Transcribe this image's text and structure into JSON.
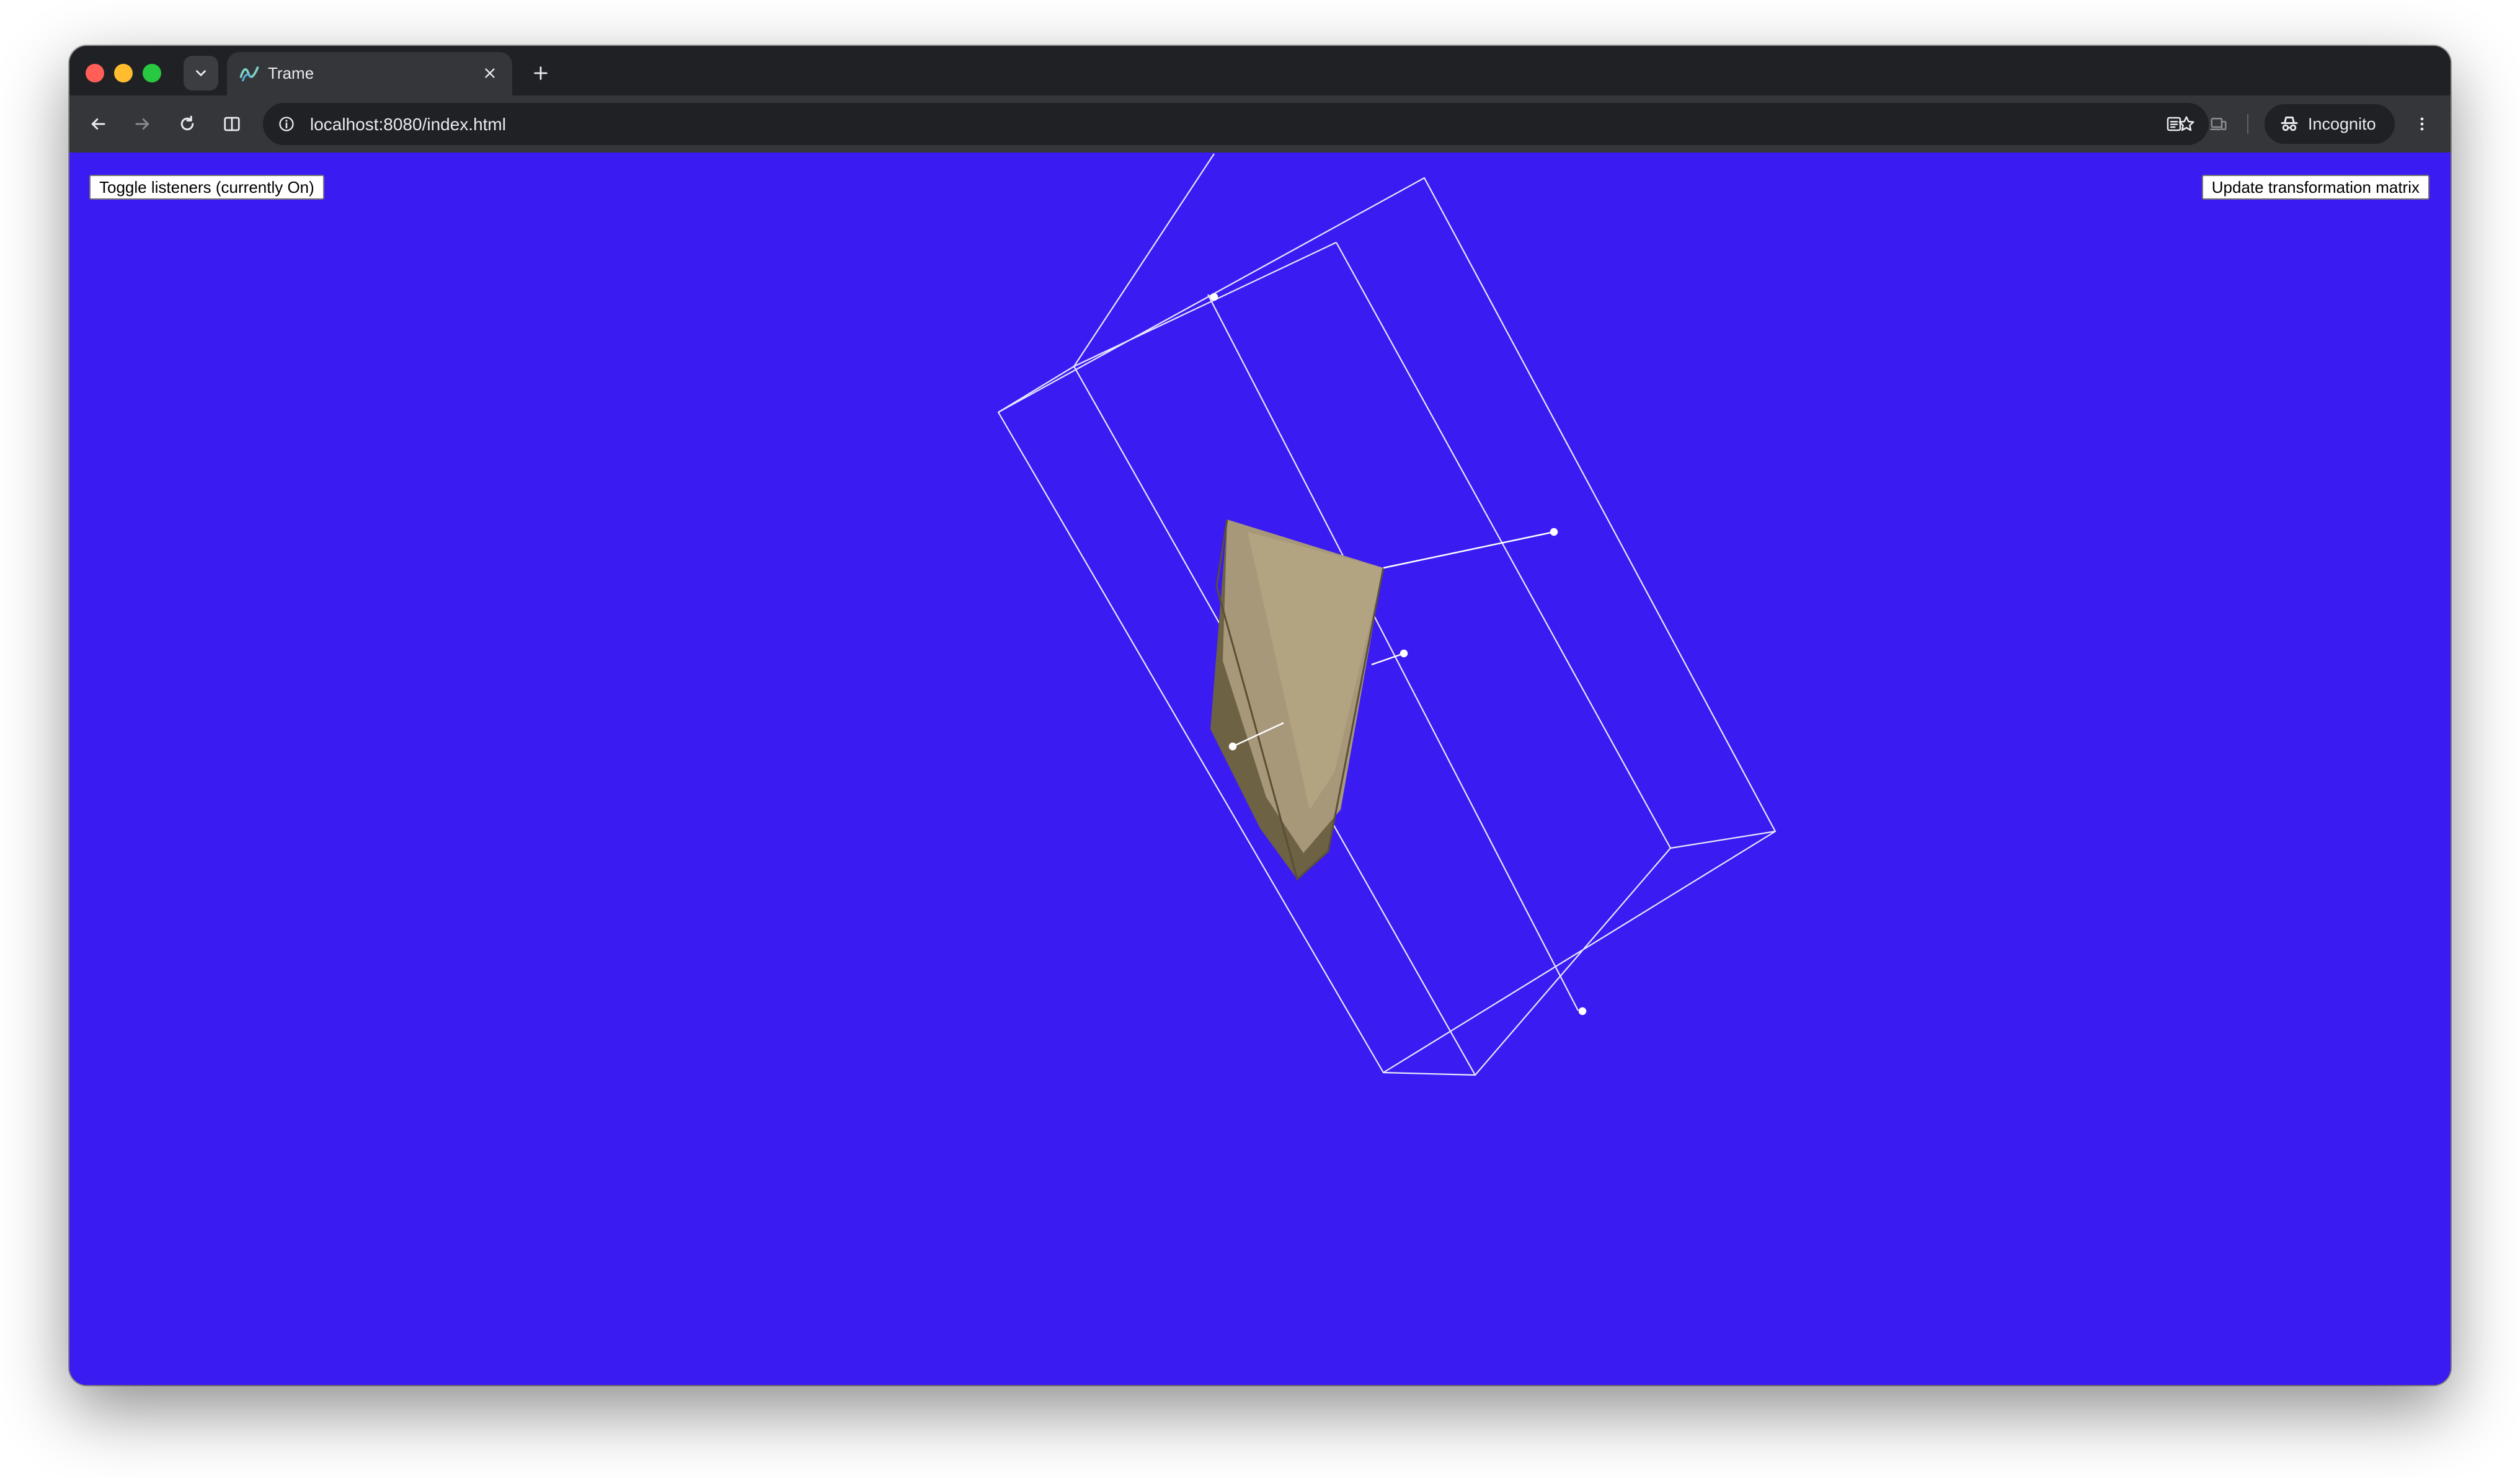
{
  "browser": {
    "tab_title": "Trame",
    "url": "localhost:8080/index.html",
    "profile_label": "Incognito",
    "icons": [
      "tab-search-icon",
      "trame-logo-icon",
      "close-icon",
      "plus-icon",
      "back-arrow-icon",
      "forward-arrow-icon",
      "reload-icon",
      "side-panel-icon",
      "info-icon",
      "star-icon",
      "reading-list-icon",
      "devices-icon",
      "incognito-icon",
      "kebab-menu-icon"
    ]
  },
  "page": {
    "background_color": "#3a1cf2",
    "toggle_listeners_label": "Toggle listeners (currently On)",
    "update_matrix_label": "Update transformation matrix"
  },
  "scene": {
    "object": "cone",
    "object_color": "#a8987a",
    "widget_color": "#ffffff",
    "widget": "bounding-box with handles"
  }
}
